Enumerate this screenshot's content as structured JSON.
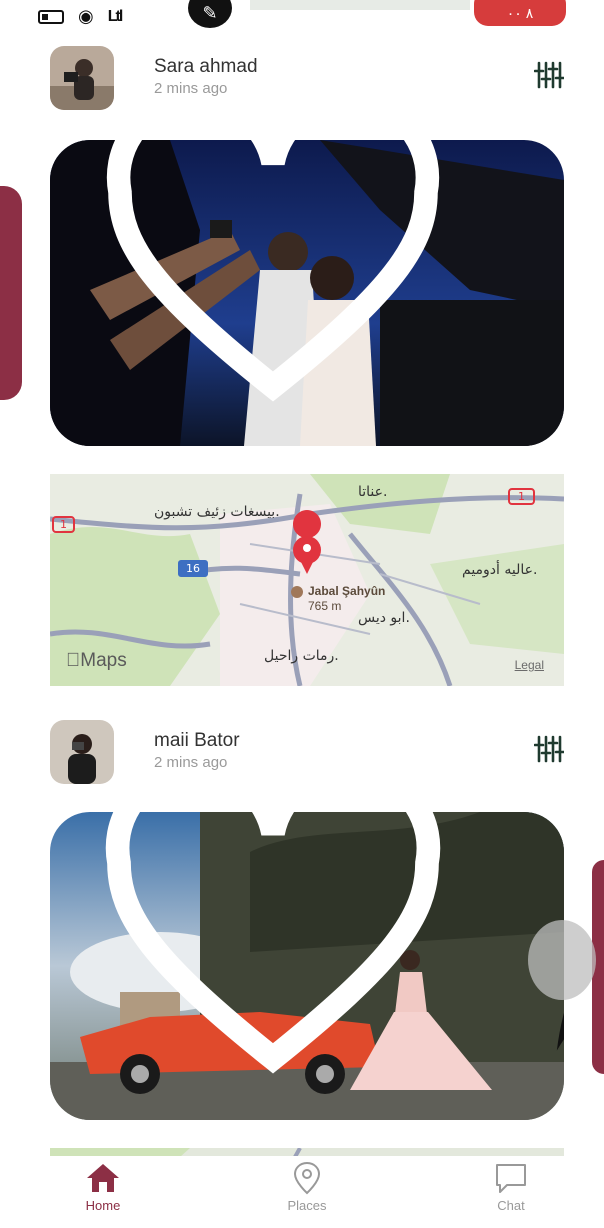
{
  "status_bar": {
    "left_text": "Ltl",
    "right_badge": "٨ ٠٠"
  },
  "colors": {
    "accent": "#8c2f45",
    "pin": "#e1343f",
    "map_green": "#cfe3b8",
    "road": "#9aa0b8"
  },
  "posts": [
    {
      "user_name": "Sara ahmad",
      "time": "2 mins ago",
      "avatar_icon": "avatar-photo",
      "filter_icon": "filter-sliders-icon",
      "like_icon": "heart-icon"
    },
    {
      "user_name": "maii Bator",
      "time": "2 mins ago",
      "avatar_icon": "avatar-photo",
      "filter_icon": "filter-sliders-icon",
      "like_icon": "heart-icon",
      "share_icon": "share-arrow-icon"
    }
  ],
  "map": {
    "labels": {
      "anata": "عناتا.",
      "pisgat": "بيسغات زئيف تشبون.",
      "maale": "عاليه أدوميم.",
      "abu_dis": "ابو ديس.",
      "ramat": "رمات راحيل.",
      "place_name": "Jabal Şahyûn",
      "elevation": "765 m",
      "road_1": "1",
      "road_16": "16",
      "road_1_left": "1"
    },
    "logo": "Maps",
    "legal": "Legal"
  },
  "nav": {
    "home": "Home",
    "places": "Places",
    "chat": "Chat"
  }
}
